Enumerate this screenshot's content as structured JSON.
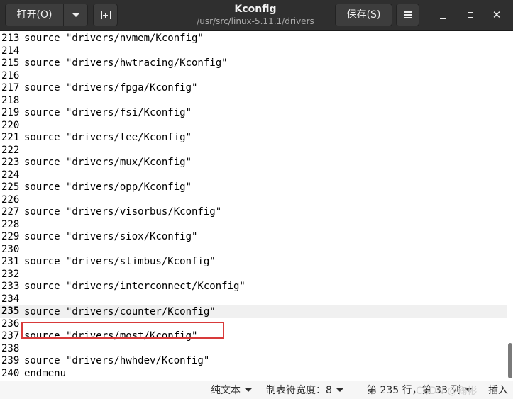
{
  "header": {
    "open_label": "打开(O)",
    "title": "Kconfig",
    "path": "/usr/src/linux-5.11.1/drivers",
    "save_label": "保存(S)",
    "close_glyph": "✕"
  },
  "icons": {
    "open_menu": "chevron-down-icon",
    "new_tab": "new-tab-icon",
    "menu": "hamburger-menu-icon",
    "minimize": "minimize-icon",
    "maximize": "maximize-icon",
    "close": "close-icon"
  },
  "editor": {
    "current_line": 235,
    "highlighted_line": 239,
    "lines": [
      {
        "n": "213",
        "text": "source \"drivers/nvmem/Kconfig\""
      },
      {
        "n": "214",
        "text": ""
      },
      {
        "n": "215",
        "text": "source \"drivers/hwtracing/Kconfig\""
      },
      {
        "n": "216",
        "text": ""
      },
      {
        "n": "217",
        "text": "source \"drivers/fpga/Kconfig\""
      },
      {
        "n": "218",
        "text": ""
      },
      {
        "n": "219",
        "text": "source \"drivers/fsi/Kconfig\""
      },
      {
        "n": "220",
        "text": ""
      },
      {
        "n": "221",
        "text": "source \"drivers/tee/Kconfig\""
      },
      {
        "n": "222",
        "text": ""
      },
      {
        "n": "223",
        "text": "source \"drivers/mux/Kconfig\""
      },
      {
        "n": "224",
        "text": ""
      },
      {
        "n": "225",
        "text": "source \"drivers/opp/Kconfig\""
      },
      {
        "n": "226",
        "text": ""
      },
      {
        "n": "227",
        "text": "source \"drivers/visorbus/Kconfig\""
      },
      {
        "n": "228",
        "text": ""
      },
      {
        "n": "229",
        "text": "source \"drivers/siox/Kconfig\""
      },
      {
        "n": "230",
        "text": ""
      },
      {
        "n": "231",
        "text": "source \"drivers/slimbus/Kconfig\""
      },
      {
        "n": "232",
        "text": ""
      },
      {
        "n": "233",
        "text": "source \"drivers/interconnect/Kconfig\""
      },
      {
        "n": "234",
        "text": ""
      },
      {
        "n": "235",
        "text": "source \"drivers/counter/Kconfig\""
      },
      {
        "n": "236",
        "text": ""
      },
      {
        "n": "237",
        "text": "source \"drivers/most/Kconfig\""
      },
      {
        "n": "238",
        "text": ""
      },
      {
        "n": "239",
        "text": "source \"drivers/hwhdev/Kconfig\""
      },
      {
        "n": "240",
        "text": "endmenu"
      }
    ]
  },
  "statusbar": {
    "language": "纯文本",
    "tab_width": "制表符宽度：8",
    "position": "第 235 行，第 33 列",
    "mode": "插入"
  },
  "watermark": "CSDN @鞠彬",
  "colors": {
    "header_bg": "#2f2f2f",
    "highlight_box": "#d83a3a",
    "current_line_bg": "#f0f0f0"
  }
}
